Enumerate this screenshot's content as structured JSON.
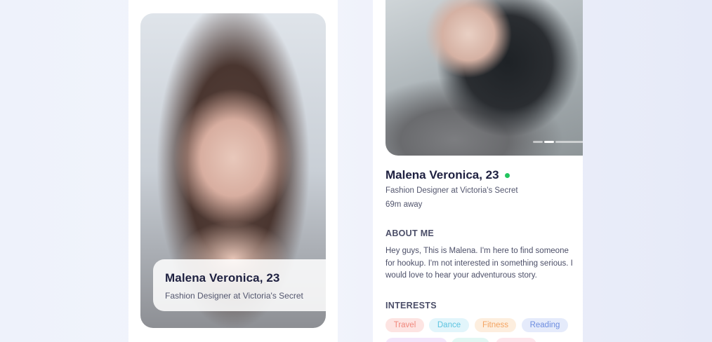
{
  "card": {
    "name": "Malena Veronica, 23",
    "title": "Fashion Designer at Victoria's Secret"
  },
  "detail": {
    "name": "Malena Veronica, 23",
    "title": "Fashion Designer at Victoria's Secret",
    "distance": "69m away",
    "online": true,
    "photo_index": 2,
    "photo_count": 3,
    "about_heading": "ABOUT ME",
    "about_text": "Hey guys, This is Malena. I'm here to find someone for hookup. I'm not interested in something serious. I would love to hear your adventurous story.",
    "interests_heading": "INTERESTS",
    "interests": [
      {
        "label": "Travel",
        "bg": "#fde4e2",
        "color": "#f0877c"
      },
      {
        "label": "Dance",
        "bg": "#e2f5fb",
        "color": "#5cc3e0"
      },
      {
        "label": "Fitness",
        "bg": "#fdeede",
        "color": "#f3a462"
      },
      {
        "label": "Reading",
        "bg": "#e5ebfb",
        "color": "#6d8de0"
      }
    ],
    "interests_row2_colors": [
      "#f2e6fb",
      "#e2f7f3",
      "#fde6ec"
    ]
  },
  "colors": {
    "online": "#22c55e",
    "text_primary": "#1e2040",
    "text_secondary": "#53566e"
  }
}
